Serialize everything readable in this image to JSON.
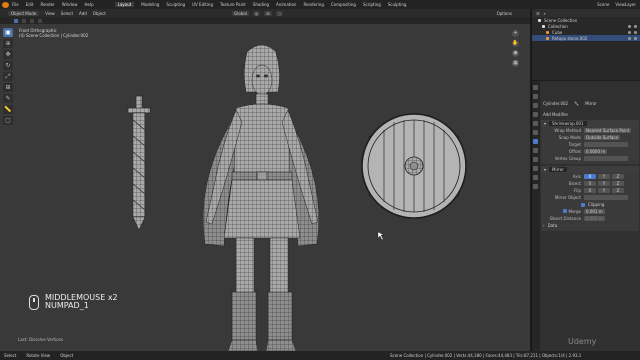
{
  "topbar": {
    "menus": [
      "File",
      "Edit",
      "Render",
      "Window",
      "Help"
    ],
    "workspaces": [
      "Layout",
      "Modeling",
      "Sculpting",
      "UV Editing",
      "Texture Paint",
      "Shading",
      "Animation",
      "Rendering",
      "Compositing",
      "Scripting",
      "Sculpting"
    ],
    "active_workspace": "Layout",
    "scene": "Scene",
    "view_layer": "ViewLayer"
  },
  "viewport_header": {
    "mode": "Object Mode",
    "menus": [
      "View",
      "Select",
      "Add",
      "Object"
    ],
    "orientation": "Global",
    "options": "Options"
  },
  "viewport": {
    "view_name": "Front Orthographic",
    "collection_info": "(4) Scene Collection | Cylinder.002",
    "last_operator": "Last: Dissolve Vertices"
  },
  "key_overlay": {
    "line1": "MIDDLEMOUSE x2",
    "line2": "NUMPAD_1",
    "icon": "mouse-icon"
  },
  "outliner": {
    "header": "Scene Collection",
    "items": [
      {
        "name": "Scene Collection"
      },
      {
        "name": "Collection"
      },
      {
        "name": "Cube"
      },
      {
        "name": "Retopo stone.002"
      }
    ]
  },
  "properties": {
    "object_name": "Cylinder.002",
    "modifier_type": "Mirror",
    "add_modifier": "Add Modifier",
    "shrinkwrap": {
      "name": "Shrinkwrap.001",
      "wrap_method_label": "Wrap Method",
      "wrap_method": "Nearest Surface Point",
      "snap_mode_label": "Snap Mode",
      "snap_mode": "Outside Surface",
      "target_label": "Target",
      "offset_label": "Offset",
      "offset": "0.0000 m",
      "vertex_group_label": "Vertex Group"
    },
    "mirror": {
      "name": "Mirror",
      "axis_label": "Axis",
      "bisect_label": "Bisect",
      "flip_label": "Flip",
      "axes": [
        "X",
        "Y",
        "Z"
      ],
      "mirror_object_label": "Mirror Object",
      "clipping_label": "Clipping",
      "merge_label": "Merge",
      "merge_value": "0.001 m",
      "bisect_distance_label": "Bisect Distance",
      "bisect_distance": "0.001 m",
      "data_label": "Data"
    }
  },
  "statusbar": {
    "select": "Select",
    "rotate": "Rotate View",
    "object": "Object",
    "stats": "Scene Collection | Cylinder.002 | Verts:44,380 | Faces:44,483 | Tris:87,211 | Objects:1/4 | 2.93.1"
  },
  "watermark": "Udemy",
  "colors": {
    "accent": "#4a7bd0",
    "viewport_bg": "#393939",
    "wire": "#1e1e1e",
    "mesh": "#a9a9a9"
  }
}
